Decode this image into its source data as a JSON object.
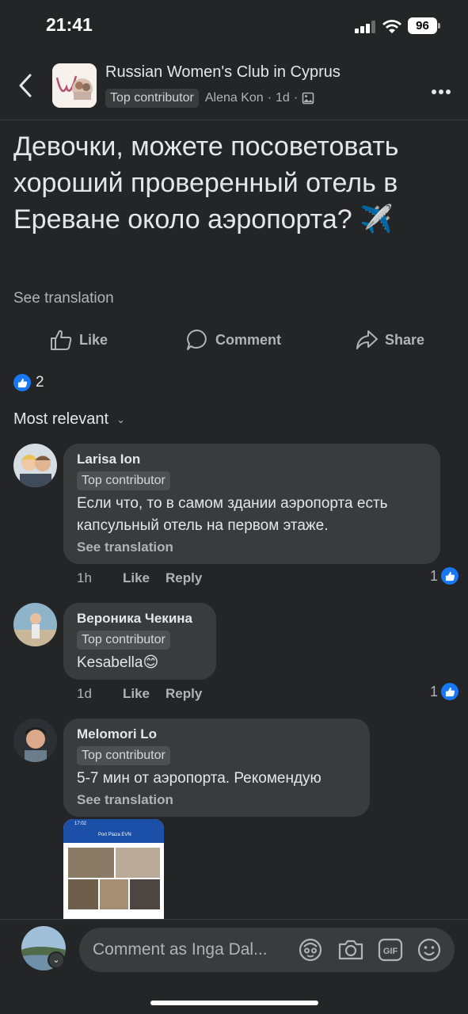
{
  "status_bar": {
    "time": "21:41",
    "battery": "96"
  },
  "header": {
    "group_name": "Russian Women's Club in Cyprus",
    "badge": "Top contributor",
    "author": "Alena Kon",
    "separator": "·",
    "age": "1d",
    "privacy_icon": "photo-icon"
  },
  "post": {
    "text": "Девочки, можете посоветовать хороший проверенный отель в Ереване около аэропорта? ✈️",
    "see_translation": "See translation"
  },
  "actions": {
    "like": "Like",
    "comment": "Comment",
    "share": "Share"
  },
  "reactions": {
    "count": "2"
  },
  "sort": {
    "label": "Most relevant"
  },
  "comments": [
    {
      "name": "Larisa Ion",
      "badge": "Top contributor",
      "text": "Если что, то в самом здании аэропорта есть капсульный отель на первом этаже.",
      "see_translation": "See translation",
      "time": "1h",
      "like": "Like",
      "reply": "Reply",
      "reactions": "1"
    },
    {
      "name": "Вероника Чекина",
      "badge": "Top contributor",
      "text": "Kesabella😊",
      "time": "1d",
      "like": "Like",
      "reply": "Reply",
      "reactions": "1"
    },
    {
      "name": "Melomori Lo",
      "badge": "Top contributor",
      "text": "5-7 мин от аэропорта. Рекомендую",
      "see_translation": "See translation",
      "attachment": {
        "time": "17:02",
        "title": "Port Plaza EVN"
      }
    }
  ],
  "composer": {
    "placeholder": "Comment as Inga Dal...",
    "icons": [
      "avatar-sticker-icon",
      "camera-icon",
      "gif-icon",
      "emoji-icon"
    ]
  },
  "colors": {
    "background": "#242526",
    "bubble": "#3a3b3c",
    "accent": "#1877f2"
  }
}
